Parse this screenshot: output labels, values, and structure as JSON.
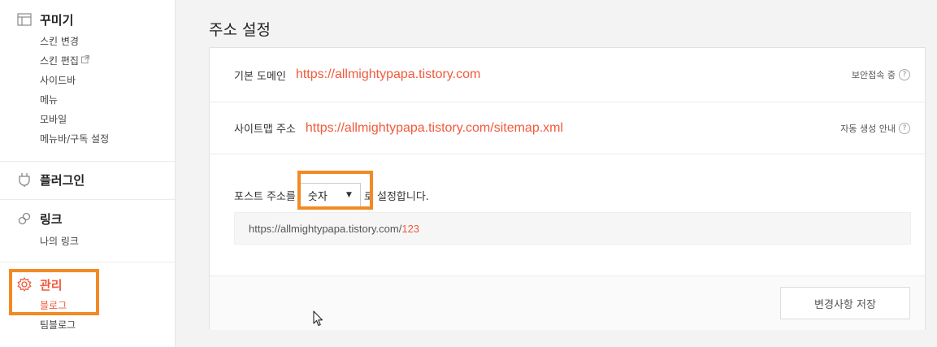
{
  "sidebar": {
    "decorate": {
      "title": "꾸미기",
      "icon": "layout-icon",
      "items": [
        "스킨 변경",
        "스킨 편집",
        "사이드바",
        "메뉴",
        "모바일",
        "메뉴바/구독 설정"
      ]
    },
    "plugin": {
      "title": "플러그인",
      "icon": "plug-icon"
    },
    "link": {
      "title": "링크",
      "icon": "link-icon",
      "items": [
        "나의 링크"
      ]
    },
    "manage": {
      "title": "관리",
      "icon": "gear-icon",
      "items": [
        "블로그",
        "팀블로그"
      ],
      "active_item": "블로그"
    }
  },
  "main": {
    "title": "주소 설정",
    "domain": {
      "label": "기본 도메인",
      "value": "https://allmightypapa.tistory.com",
      "hint": "보안접속 중"
    },
    "sitemap": {
      "label": "사이트맵 주소",
      "value": "https://allmightypapa.tistory.com/sitemap.xml",
      "hint": "자동 생성 안내"
    },
    "post_address": {
      "prefix": "포스트 주소를",
      "selected": "숫자",
      "suffix": "로 설정합니다.",
      "preview_base": "https://allmightypapa.tistory.com/",
      "preview_num": "123"
    },
    "save_label": "변경사항 저장"
  },
  "colors": {
    "accent": "#f05a3c",
    "highlight": "#f28a24"
  }
}
